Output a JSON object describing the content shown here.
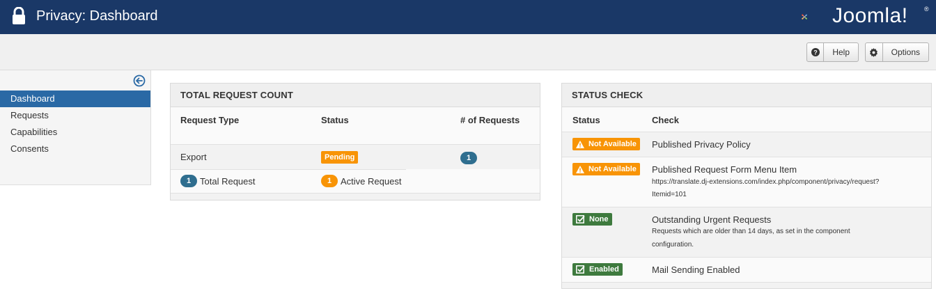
{
  "header": {
    "title": "Privacy: Dashboard",
    "logo_text": "Joomla!",
    "logo_reg": "®"
  },
  "toolbar": {
    "help_label": "Help",
    "options_label": "Options"
  },
  "sidebar": {
    "items": [
      {
        "label": "Dashboard",
        "active": true
      },
      {
        "label": "Requests"
      },
      {
        "label": "Capabilities"
      },
      {
        "label": "Consents"
      }
    ]
  },
  "request_count": {
    "title": "TOTAL REQUEST COUNT",
    "columns": [
      "Request Type",
      "Status",
      "# of Requests"
    ],
    "row": {
      "type": "Export",
      "status": "Pending",
      "count": "1"
    },
    "totals": {
      "total_count": "1",
      "total_label": "Total Request",
      "active_count": "1",
      "active_label": "Active Request"
    }
  },
  "status_check": {
    "title": "STATUS CHECK",
    "columns": [
      "Status",
      "Check"
    ],
    "rows": [
      {
        "status": "Not Available",
        "check": "Published Privacy Policy",
        "note": ""
      },
      {
        "status": "Not Available",
        "check": "Published Request Form Menu Item",
        "note_line1": "https://translate.dj-extensions.com/index.php/component/privacy/request?",
        "note_line2": "Itemid=101"
      },
      {
        "status": "None",
        "check": "Outstanding Urgent Requests",
        "note_line1": "Requests which are older than 14 days, as set in the component",
        "note_line2": "configuration."
      },
      {
        "status": "Enabled",
        "check": "Mail Sending Enabled"
      }
    ]
  },
  "colors": {
    "header_bg": "#1a3867",
    "accent": "#2a69a5",
    "warning": "#f89406",
    "success": "#3e7a3e"
  }
}
